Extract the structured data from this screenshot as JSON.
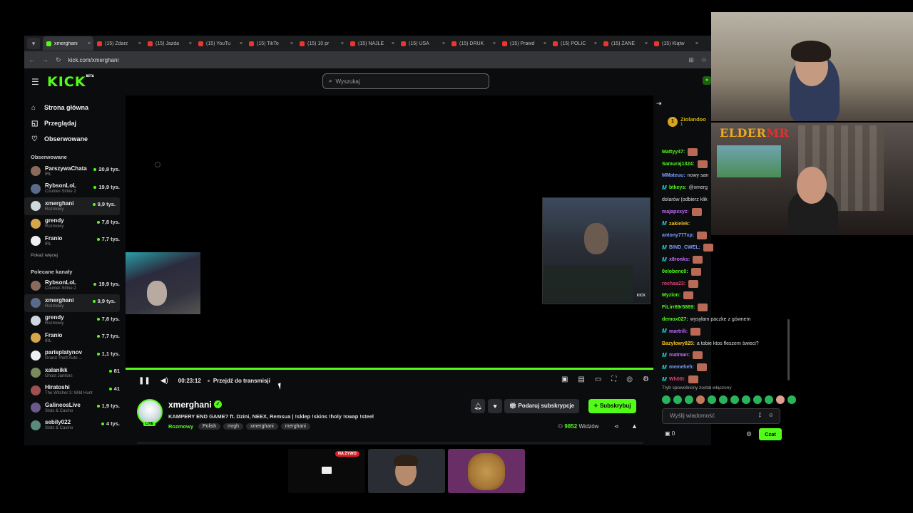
{
  "browser": {
    "tabs": [
      {
        "label": "xmerghani",
        "active": true,
        "icon": "kick-favicon"
      },
      {
        "label": "(15) Zdarz",
        "active": false,
        "icon": "youtube-favicon"
      },
      {
        "label": "(15) Jazda",
        "active": false,
        "icon": "youtube-favicon"
      },
      {
        "label": "(15) YouTu",
        "active": false,
        "icon": "youtube-favicon"
      },
      {
        "label": "(15) TikTo",
        "active": false,
        "icon": "youtube-favicon"
      },
      {
        "label": "(15) 10 pr",
        "active": false,
        "icon": "youtube-favicon"
      },
      {
        "label": "(15) NAJLE",
        "active": false,
        "icon": "youtube-favicon"
      },
      {
        "label": "(15) USA",
        "active": false,
        "icon": "youtube-favicon"
      },
      {
        "label": "(15) DRUK",
        "active": false,
        "icon": "youtube-favicon"
      },
      {
        "label": "(15) Prawd",
        "active": false,
        "icon": "youtube-favicon"
      },
      {
        "label": "(15) POLIC",
        "active": false,
        "icon": "youtube-favicon"
      },
      {
        "label": "(15) ZANE",
        "active": false,
        "icon": "youtube-favicon"
      },
      {
        "label": "(15) Klątw",
        "active": false,
        "icon": "youtube-favicon"
      }
    ],
    "url": "kick.com/xmerghani"
  },
  "header": {
    "logo": "KICK",
    "logo_badge": "BETA",
    "search_placeholder": "Wyszukaj"
  },
  "sidebar": {
    "nav": [
      {
        "label": "Strona główna",
        "icon": "home-icon"
      },
      {
        "label": "Przeglądaj",
        "icon": "browse-icon"
      },
      {
        "label": "Obserwowane",
        "icon": "heart-icon"
      }
    ],
    "followed_title": "Obserwowane",
    "followed": [
      {
        "name": "ParszywaChata",
        "category": "IRL",
        "viewers": "20,8 tys."
      },
      {
        "name": "RybsonLoL",
        "category": "Counter-Strike 2",
        "viewers": "19,9 tys."
      },
      {
        "name": "xmerghani",
        "category": "Rozmowy",
        "viewers": "9,9 tys.",
        "selected": true
      },
      {
        "name": "grendy",
        "category": "Rozmowy",
        "viewers": "7,8 tys."
      },
      {
        "name": "Franio",
        "category": "IRL",
        "viewers": "7,7 tys."
      }
    ],
    "show_more": "Pokaż więcej",
    "recommended_title": "Polecane kanały",
    "recommended": [
      {
        "name": "RybsonLoL",
        "category": "Counter-Strike 2",
        "viewers": "19,9 tys."
      },
      {
        "name": "xmerghani",
        "category": "Rozmowy",
        "viewers": "9,9 tys.",
        "selected": true
      },
      {
        "name": "grendy",
        "category": "Rozmowy",
        "viewers": "7,8 tys."
      },
      {
        "name": "Franio",
        "category": "IRL",
        "viewers": "7,7 tys."
      },
      {
        "name": "parisplatynov",
        "category": "Grand Theft Auto ...",
        "viewers": "1,1 tys."
      },
      {
        "name": "xalanikk",
        "category": "Ghost Janitors",
        "viewers": "81"
      },
      {
        "name": "Hiratoshi",
        "category": "The Witcher 3: Wild Hunt",
        "viewers": "41"
      },
      {
        "name": "GalineosLive",
        "category": "Slots & Casino",
        "viewers": "1,9 tys."
      },
      {
        "name": "sebily022",
        "category": "Slots & Casino",
        "viewers": "4 tys."
      }
    ]
  },
  "player": {
    "time": "00:23:12",
    "jump_live": "Przejdź do transmisji",
    "progress": 1.0,
    "pip_watermark": "KICK"
  },
  "stream": {
    "name": "xmerghani",
    "live_badge": "LIVE",
    "title": "KAMPERY END GAME? ft. Dzini, NEEX, Remsua | !sklep !skins !holy !swap !steel",
    "category": "Rozmowy",
    "tags": [
      "Polish",
      "mrgh",
      "xmerghani",
      "merghani"
    ],
    "gift_label": "Podaruj subskrypcje",
    "subscribe_label": "Subskrybuj",
    "viewers_count": "9852",
    "viewers_label": "Widzów"
  },
  "chat": {
    "pinned": {
      "rank": "1",
      "name": "Ziolandoo",
      "count": "1"
    },
    "messages": [
      {
        "user": "Mattyy47:",
        "color": "#53fc18",
        "text": "",
        "badge": false,
        "emote": true
      },
      {
        "user": "Samuraj1324:",
        "color": "#53fc18",
        "text": "",
        "badge": false,
        "emote": true
      },
      {
        "user": "MMateuu:",
        "color": "#7b9cff",
        "text": "nowy san",
        "badge": false,
        "emote": false
      },
      {
        "user": "btkeys:",
        "color": "#53fc18",
        "text": "@xmerg",
        "badge": true,
        "emote": false
      },
      {
        "user": "",
        "color": "#ddd",
        "text": "dolarów (odbierz klik",
        "badge": false,
        "emote": false
      },
      {
        "user": "majapxxyz:",
        "color": "#c26bff",
        "text": "",
        "badge": false,
        "emote": true
      },
      {
        "user": "zakielek:",
        "color": "#f0c020",
        "text": "",
        "badge": true,
        "emote": false
      },
      {
        "user": "antony777xp:",
        "color": "#7b9cff",
        "text": "",
        "badge": false,
        "emote": true
      },
      {
        "user": "BIND_CWEL:",
        "color": "#7b9cff",
        "text": "",
        "badge": true,
        "emote": true
      },
      {
        "user": "x8ronks:",
        "color": "#c26bff",
        "text": "",
        "badge": true,
        "emote": true
      },
      {
        "user": "0elobenc0:",
        "color": "#53fc18",
        "text": "",
        "badge": false,
        "emote": true
      },
      {
        "user": "rochaa23:",
        "color": "#e0407a",
        "text": "",
        "badge": false,
        "emote": true
      },
      {
        "user": "Myzion:",
        "color": "#53fc18",
        "text": "",
        "badge": false,
        "emote": true
      },
      {
        "user": "FiLirr69r5869:",
        "color": "#53fc18",
        "text": "",
        "badge": false,
        "emote": true
      },
      {
        "user": "demox027:",
        "color": "#53fc18",
        "text": "wysyłam paczke z gównem",
        "badge": false,
        "emote": false
      },
      {
        "user": "martrili:",
        "color": "#c26bff",
        "text": "",
        "badge": true,
        "emote": true
      },
      {
        "user": "Bazylowy825:",
        "color": "#f0c020",
        "text": "a tobie ktos fleszem świeci?",
        "badge": false,
        "emote": false
      },
      {
        "user": "matman:",
        "color": "#c26bff",
        "text": "",
        "badge": true,
        "emote": true
      },
      {
        "user": "memeheh:",
        "color": "#7b9cff",
        "text": "",
        "badge": true,
        "emote": true
      },
      {
        "user": "Wh00t:",
        "color": "#e0407a",
        "text": "",
        "badge": true,
        "emote": true
      }
    ],
    "slow_mode": "Tryb spowolniony został włączony",
    "input_placeholder": "Wyślij wiadomość",
    "points": "0",
    "send_label": "Czat"
  },
  "overlay": {
    "brand_a": "ELDER",
    "brand_b": "MR",
    "live_badge": "NA ŻYWO"
  }
}
